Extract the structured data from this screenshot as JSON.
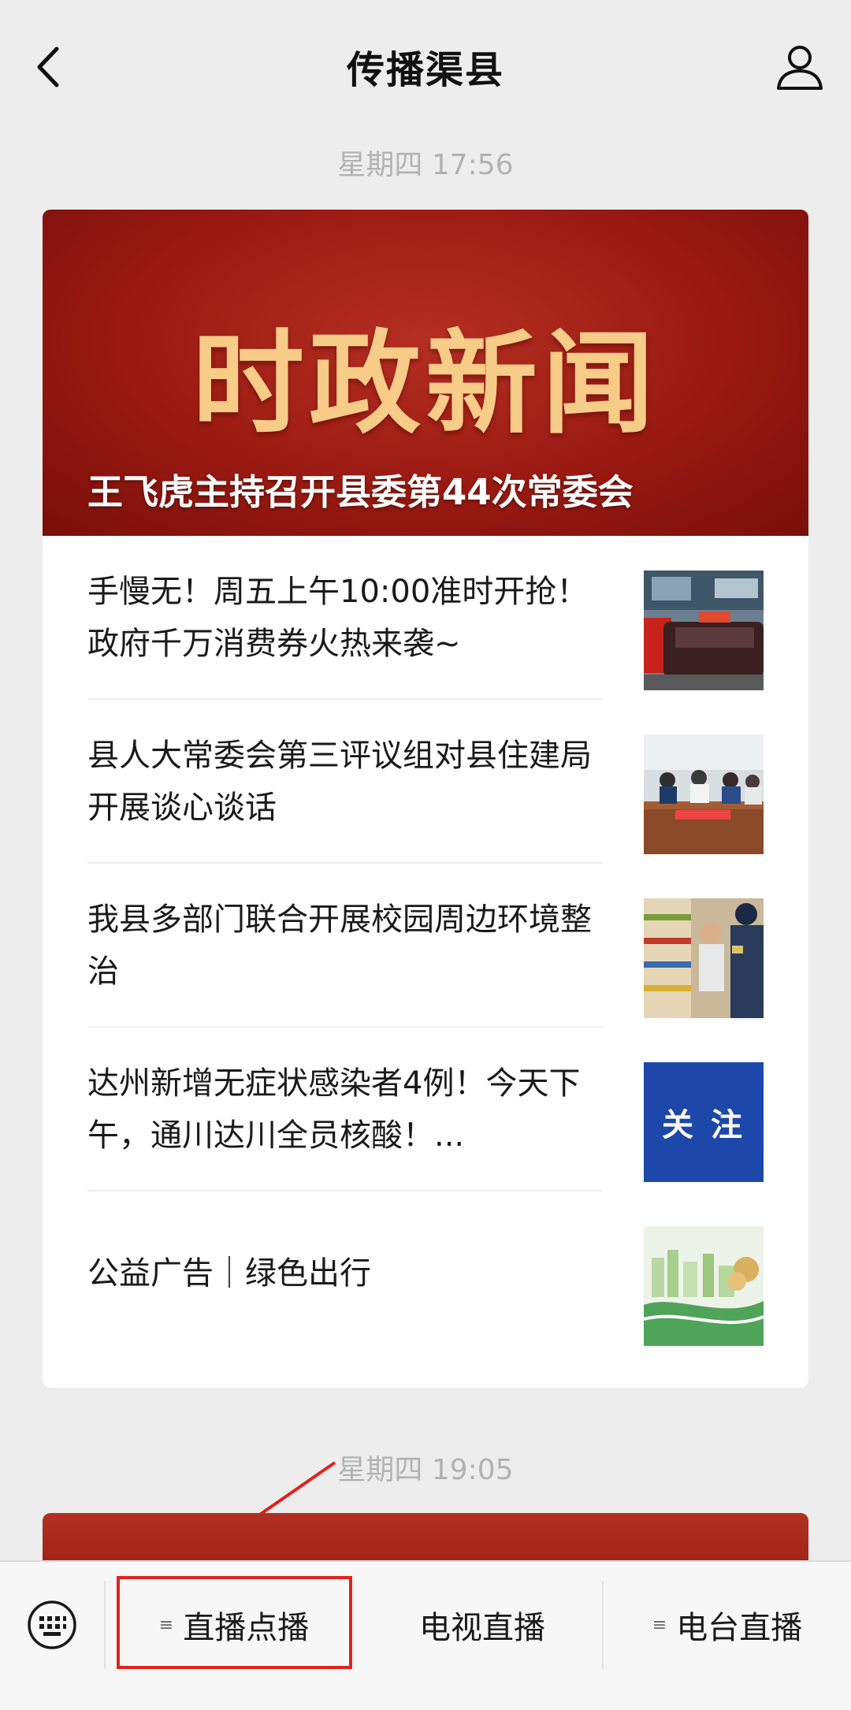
{
  "nav": {
    "title": "传播渠县"
  },
  "timestamps": [
    "星期四 17:56",
    "星期四 19:05"
  ],
  "banner": {
    "title": "时政新闻",
    "headline": "王飞虎主持召开县委第44次常委会"
  },
  "articles": [
    {
      "title": "手慢无！周五上午10:00准时开抢！政府千万消费券火热来袭~"
    },
    {
      "title": "县人大常委会第三评议组对县住建局开展谈心谈话"
    },
    {
      "title": "我县多部门联合开展校园周边环境整治"
    },
    {
      "title": "达州新增无症状感染者4例！今天下午，通川达川全员核酸！...",
      "thumb_text": "关 注"
    },
    {
      "title": "公益广告｜绿色出行"
    }
  ],
  "menu": {
    "items": [
      "直播点播",
      "电视直播",
      "电台直播"
    ]
  },
  "colors": {
    "accent_red": "#e0231c",
    "banner_red": "#991a12",
    "banner_gold": "#f6cc88",
    "thumb_blue": "#1d47a8"
  }
}
